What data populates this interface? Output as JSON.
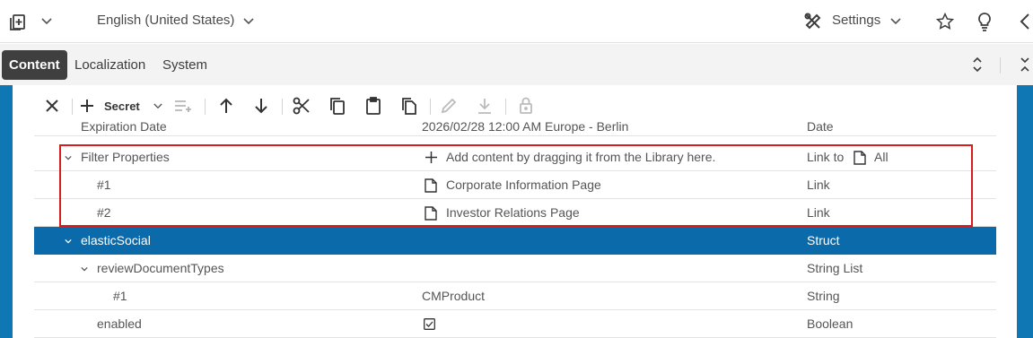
{
  "header": {
    "doc_menu_icon": "clipboard-plus-icon",
    "language": "English (United States)",
    "settings_label": "Settings",
    "icons": [
      "star-icon",
      "lightbulb-icon",
      "chevron-left-icon"
    ]
  },
  "tabs": [
    {
      "label": "Content",
      "active": true
    },
    {
      "label": "Localization",
      "active": false
    },
    {
      "label": "System",
      "active": false
    }
  ],
  "toolbar": {
    "secret_label": "Secret"
  },
  "grid": {
    "rows": [
      {
        "name": "Expiration Date",
        "value": "2026/02/28 12:00 AM Europe - Berlin",
        "type": "Date"
      },
      {
        "name": "Filter Properties",
        "value": "Add content by dragging it from the Library here.",
        "type": "Link to",
        "type_extra": "All"
      },
      {
        "name": "#1",
        "value": "Corporate Information Page",
        "type": "Link"
      },
      {
        "name": "#2",
        "value": "Investor Relations Page",
        "type": "Link"
      },
      {
        "name": "elasticSocial",
        "value": "",
        "type": "Struct"
      },
      {
        "name": "reviewDocumentTypes",
        "value": "",
        "type": "String List"
      },
      {
        "name": "#1",
        "value": "CMProduct",
        "type": "String"
      },
      {
        "name": "enabled",
        "value": "",
        "type": "Boolean",
        "checked": true
      }
    ]
  },
  "colors": {
    "accent_blue": "#0f78b4",
    "selected_row": "#0b6aaa",
    "highlight_border": "#d91d1d",
    "tab_active": "#3f3f3f"
  }
}
